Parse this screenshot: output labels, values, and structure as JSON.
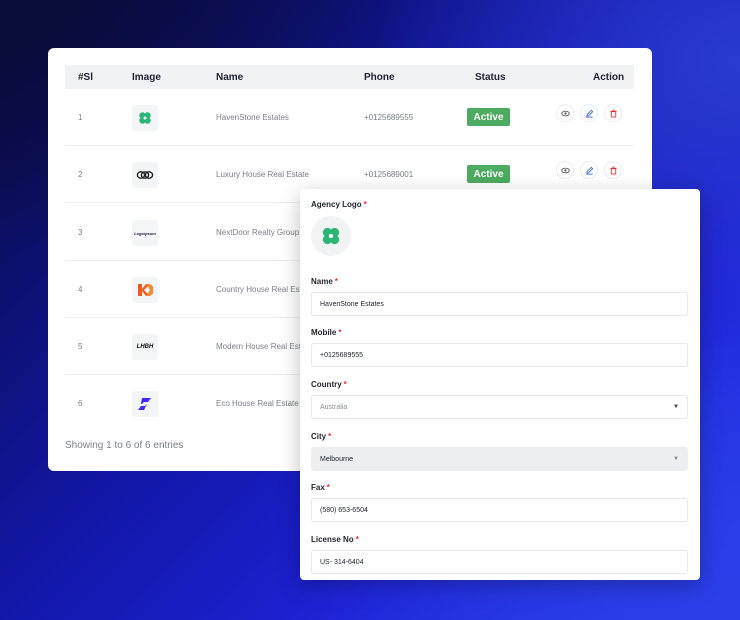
{
  "table": {
    "headers": {
      "sl": "#Sl",
      "image": "Image",
      "name": "Name",
      "phone": "Phone",
      "status": "Status",
      "action": "Action"
    },
    "rows": [
      {
        "sl": "1",
        "name": "HavenStone Estates",
        "phone": "+0125689555",
        "status": "Active",
        "logo": "clover-logo"
      },
      {
        "sl": "2",
        "name": "Luxury House Real Estate",
        "phone": "+0125689001",
        "status": "Active",
        "logo": "chain-logo"
      },
      {
        "sl": "3",
        "name": "NextDoor Realty Group",
        "phone": "",
        "status": "",
        "logo": "logoipsum-logo",
        "logo_text": "Logoipsum"
      },
      {
        "sl": "4",
        "name": "Country House Real Estate",
        "phone": "",
        "status": "",
        "logo": "kd-logo"
      },
      {
        "sl": "5",
        "name": "Modern House Real Estate",
        "phone": "",
        "status": "",
        "logo": "lhbh-logo",
        "logo_text": "LHBH"
      },
      {
        "sl": "6",
        "name": "Eco House Real Estate",
        "phone": "",
        "status": "",
        "logo": "s-logo"
      }
    ],
    "footer": "Showing 1 to 6 of 6 entries",
    "colors": {
      "active": "#4caa61",
      "view": "#555555",
      "edit": "#3b6fe0",
      "delete": "#e03131"
    }
  },
  "form": {
    "agency_logo_label": "Agency Logo",
    "name_label": "Name",
    "name_value": "HavenStone Estates",
    "mobile_label": "Mobile",
    "mobile_value": "+0125689555",
    "country_label": "Country",
    "country_value": "Australia",
    "city_label": "City",
    "city_value": "Melbourne",
    "fax_label": "Fax",
    "fax_value": "(580) 653-6504",
    "license_label": "License No",
    "license_value": "US- 314-6404",
    "required_mark": "*"
  }
}
